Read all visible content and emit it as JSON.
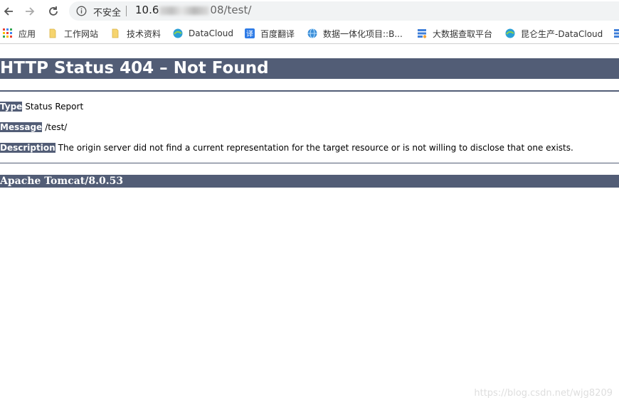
{
  "browser": {
    "security_label": "不安全",
    "url_prefix": "10.6",
    "url_suffix": "08/test/"
  },
  "bookmarks": [
    {
      "label": "应用",
      "icon": "apps-grid-icon"
    },
    {
      "label": "工作网站",
      "icon": "folder-icon"
    },
    {
      "label": "技术资料",
      "icon": "folder-icon"
    },
    {
      "label": "DataCloud",
      "icon": "datacloud-icon"
    },
    {
      "label": "百度翻译",
      "icon": "baidu-translate-icon"
    },
    {
      "label": "数据一体化项目::B...",
      "icon": "globe-icon"
    },
    {
      "label": "大数据查取平台",
      "icon": "data-platform-icon"
    },
    {
      "label": "昆仑生产-DataCloud",
      "icon": "datacloud-icon"
    }
  ],
  "page": {
    "title": "HTTP Status 404 – Not Found",
    "type_key": "Type",
    "type_value": "Status Report",
    "message_key": "Message",
    "message_value": "/test/",
    "description_key": "Description",
    "description_value": "The origin server did not find a current representation for the target resource or is not willing to disclose that one exists.",
    "server": "Apache Tomcat/8.0.53"
  },
  "watermark": "https://blog.csdn.net/wjg8209",
  "colors": {
    "tomcat_header": "#525d76"
  }
}
